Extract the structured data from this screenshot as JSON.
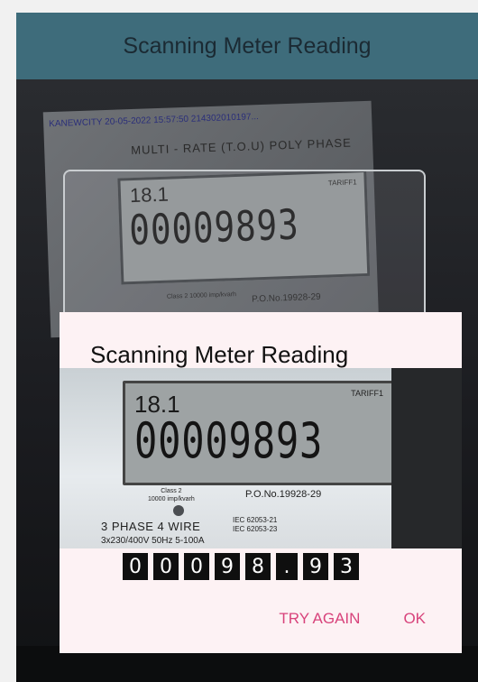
{
  "app_bar": {
    "title": "Scanning Meter Reading"
  },
  "camera_preview": {
    "paper_text": "KANEWCITY 20-05-2022 15:57:50 214302010197...",
    "meter_header": "MULTI - RATE (T.O.U) POLY PHASE",
    "lcd_code": "18.1",
    "lcd_digits": "00009893",
    "lcd_tariff": "TARIFF1",
    "class_label": "Class 2 10000 imp/kvarh",
    "po_label": "P.O.No.19928-29"
  },
  "dialog": {
    "title": "Scanning Meter Reading",
    "photo": {
      "lcd_code": "18.1",
      "lcd_digits": "00009893",
      "lcd_tariff": "TARIFF1",
      "class_label": "Class 2",
      "class_sub": "10000 imp/kvarh",
      "po_label": "P.O.No.19928-29",
      "phase_label": "3 PHASE 4 WIRE",
      "iec_1": "IEC 62053-21",
      "iec_2": "IEC 62053-23",
      "voltage": "3x230/400V 50Hz 5-100A"
    },
    "reading_digits": [
      "0",
      "0",
      "0",
      "9",
      "8",
      ".",
      "9",
      "3"
    ],
    "actions": {
      "try_again": "TRY AGAIN",
      "ok": "OK"
    }
  },
  "colors": {
    "app_bar": "#3e6c7b",
    "dialog_bg": "#fdf2f4",
    "accent": "#d8437b"
  }
}
